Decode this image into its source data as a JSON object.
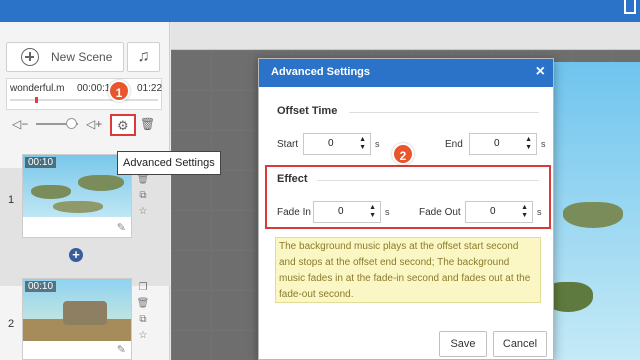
{
  "colors": {
    "accent": "#2b73c9",
    "highlight": "#d93a3a",
    "badge": "#e9552c",
    "note_bg": "#fbf7c5"
  },
  "topbar": {
    "icon": "home-icon"
  },
  "left_panel": {
    "new_scene_label": "New Scene",
    "music_list_icon": "music-list-icon",
    "music": {
      "name": "wonderful.m",
      "start": "00:00:1",
      "end": "01:22"
    },
    "controls": {
      "volume_down_icon": "volume-down-icon",
      "volume_up_icon": "volume-up-icon",
      "settings_icon": "gear-icon",
      "delete_icon": "trash-icon"
    },
    "tooltip": "Advanced Settings",
    "scenes": [
      {
        "number": "1",
        "time": "00:10"
      },
      {
        "number": "2",
        "time": "00:10"
      }
    ]
  },
  "badges": {
    "one": "1",
    "two": "2"
  },
  "dialog": {
    "title": "Advanced Settings",
    "close_icon": "close-icon",
    "offset_section": "Offset Time",
    "start_label": "Start",
    "start_value": "0",
    "end_label": "End",
    "end_value": "0",
    "unit": "s",
    "effect_section": "Effect",
    "fade_in_label": "Fade In",
    "fade_in_value": "0",
    "fade_out_label": "Fade Out",
    "fade_out_value": "0",
    "note": "The background music plays at the offset start second and stops at the offset end second; The background music fades in at the fade-in second and fades out at the fade-out second.",
    "save_label": "Save",
    "cancel_label": "Cancel"
  }
}
